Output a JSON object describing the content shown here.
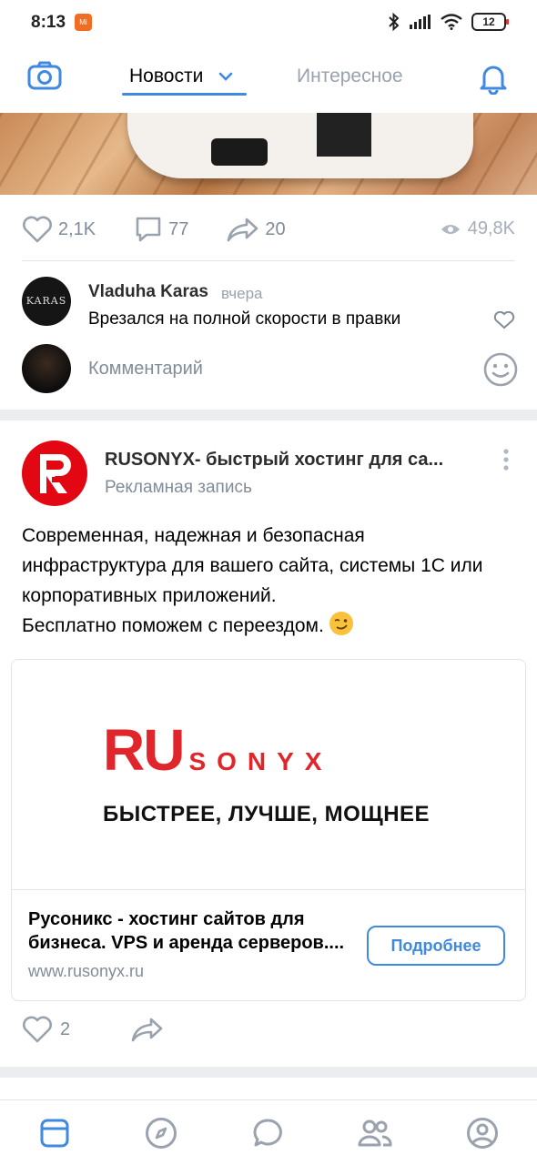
{
  "status_bar": {
    "time": "8:13",
    "app_badge": "Mi",
    "battery": "12"
  },
  "header": {
    "tabs": [
      {
        "label": "Новости",
        "active": true
      },
      {
        "label": "Интересное",
        "active": false
      }
    ],
    "icons": {
      "left": "camera-icon",
      "right": "bell-icon"
    },
    "accent_color": "#3f8ae0"
  },
  "post1": {
    "likes": "2,1K",
    "comments": "77",
    "shares": "20",
    "views": "49,8K",
    "top_comment": {
      "avatar_text": "KARAS",
      "author": "Vladuha Karas",
      "time": "вчера",
      "text": "Врезался на полной скорости в правки"
    },
    "comment_placeholder": "Комментарий"
  },
  "ad_post": {
    "avatar_letter": "R",
    "title": "RUSONYX- быстрый хостинг для са...",
    "subtitle": "Рекламная запись",
    "text_lines": [
      "Современная, надежная и безопасная",
      "инфраструктура для вашего сайта, системы 1С или",
      "корпоративных приложений.",
      "Бесплатно поможем с переездом."
    ],
    "banner": {
      "logo_main": "RU",
      "logo_rest": "SONYX",
      "tagline": "БЫСТРЕЕ, ЛУЧШЕ, МОЩНЕЕ"
    },
    "link_title": "Русоникс - хостинг сайтов для бизнеса. VPS и аренда серверов....",
    "link_url": "www.rusonyx.ru",
    "button_label": "Подробнее",
    "likes": "2"
  },
  "bottom_nav": [
    {
      "name": "feed",
      "icon": "news-feed-icon",
      "active": true
    },
    {
      "name": "discover",
      "icon": "compass-icon",
      "active": false
    },
    {
      "name": "messages",
      "icon": "chat-icon",
      "active": false
    },
    {
      "name": "friends",
      "icon": "friends-icon",
      "active": false
    },
    {
      "name": "profile",
      "icon": "profile-icon",
      "active": false
    }
  ]
}
